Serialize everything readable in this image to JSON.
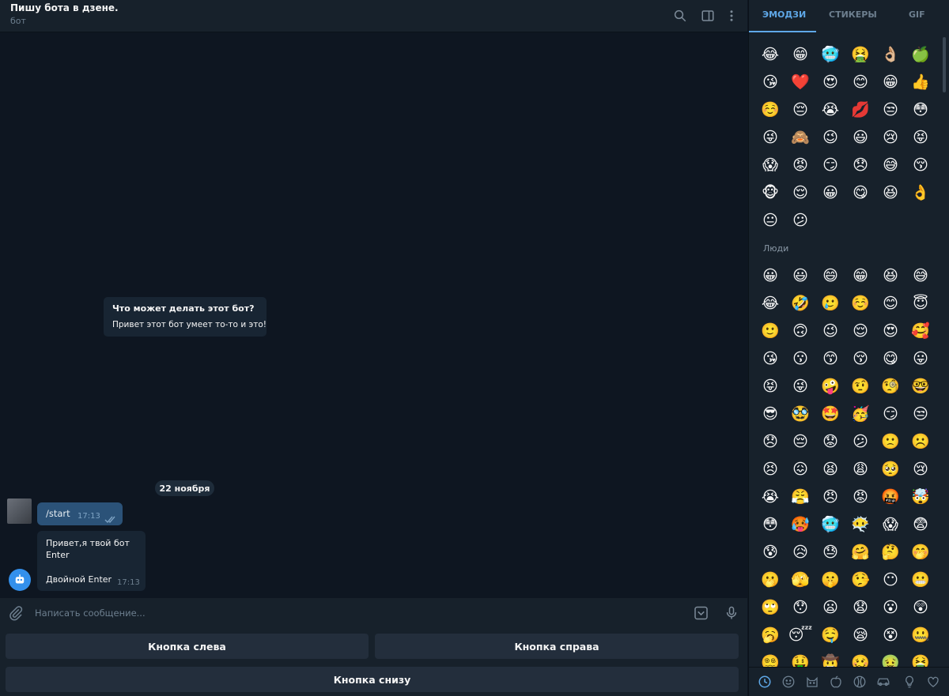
{
  "header": {
    "title": "Пишу бота в дзене.",
    "status": "бот",
    "icons": [
      "search-icon",
      "sidebar-toggle-icon",
      "more-vertical-icon"
    ]
  },
  "bot_info": {
    "title": "Что может делать этот бот?",
    "text": "Привет этот бот умеет то-то и это!"
  },
  "date_separator": "22 ноября",
  "messages": [
    {
      "direction": "out",
      "text": "/start",
      "time": "17:13",
      "status": "read"
    },
    {
      "direction": "in",
      "lines": [
        "Привет,я твой бот",
        "Enter",
        "Двойной Enter"
      ],
      "time": "17:13"
    }
  ],
  "composer": {
    "placeholder": "Написать сообщение...",
    "icons": [
      "attach-icon",
      "keyboard-icon",
      "microphone-icon"
    ]
  },
  "keyboard": {
    "left": "Кнопка слева",
    "right": "Кнопка справа",
    "bottom": "Кнопка снизу"
  },
  "emoji_panel": {
    "tabs": [
      "ЭМОДЗИ",
      "СТИКЕРЫ",
      "GIF"
    ],
    "active_tab": "ЭМОДЗИ",
    "recent": [
      "😂",
      "😁",
      "🥶",
      "🤮",
      "👌🏼",
      "🍏",
      "😘",
      "❤️",
      "😍",
      "😊",
      "😁",
      "👍",
      "☺️",
      "😔",
      "😭",
      "💋",
      "😒",
      "😳",
      "😜",
      "🙈",
      "😉",
      "😃",
      "😢",
      "😝",
      "😱",
      "😡",
      "😏",
      "😞",
      "😅",
      "😚",
      "🐵",
      "😌",
      "😀",
      "😋",
      "😆",
      "👌",
      "😐",
      "😕"
    ],
    "section_people": "Люди",
    "people": [
      "😀",
      "😃",
      "😄",
      "😁",
      "😆",
      "😅",
      "😂",
      "🤣",
      "🥲",
      "☺️",
      "😊",
      "😇",
      "🙂",
      "🙃",
      "😉",
      "😌",
      "😍",
      "🥰",
      "😘",
      "😗",
      "😙",
      "😚",
      "😋",
      "😛",
      "😝",
      "😜",
      "🤪",
      "🤨",
      "🧐",
      "🤓",
      "😎",
      "🥸",
      "🤩",
      "🥳",
      "😏",
      "😒",
      "😞",
      "😔",
      "😟",
      "😕",
      "🙁",
      "☹️",
      "😣",
      "😖",
      "😫",
      "😩",
      "🥺",
      "😢",
      "😭",
      "😤",
      "😠",
      "😡",
      "🤬",
      "🤯",
      "😳",
      "🥵",
      "🥶",
      "😶‍🌫️",
      "😱",
      "😨",
      "😰",
      "😥",
      "😓",
      "🤗",
      "🤔",
      "🤭",
      "🫢",
      "🫣",
      "🤫",
      "🤥",
      "😶",
      "😬",
      "🙄",
      "😯",
      "😦",
      "😧",
      "😮",
      "😲",
      "🥱",
      "😴",
      "🤤",
      "😪",
      "😵",
      "🤐",
      "😵‍💫",
      "🤑",
      "🤠",
      "🥴",
      "🤢",
      "🤮"
    ],
    "categories": [
      "clock-icon",
      "smile-icon",
      "cat-icon",
      "apple-icon",
      "ball-icon",
      "car-icon",
      "lightbulb-icon",
      "heart-icon"
    ],
    "active_category": "clock-icon"
  },
  "colors": {
    "chat_bg": "#0e1621",
    "panel_bg": "#17212b",
    "outgoing_bubble": "#2b5278",
    "incoming_bubble": "#182533",
    "accent": "#5fa8e8",
    "button_bg": "#232e3c"
  }
}
